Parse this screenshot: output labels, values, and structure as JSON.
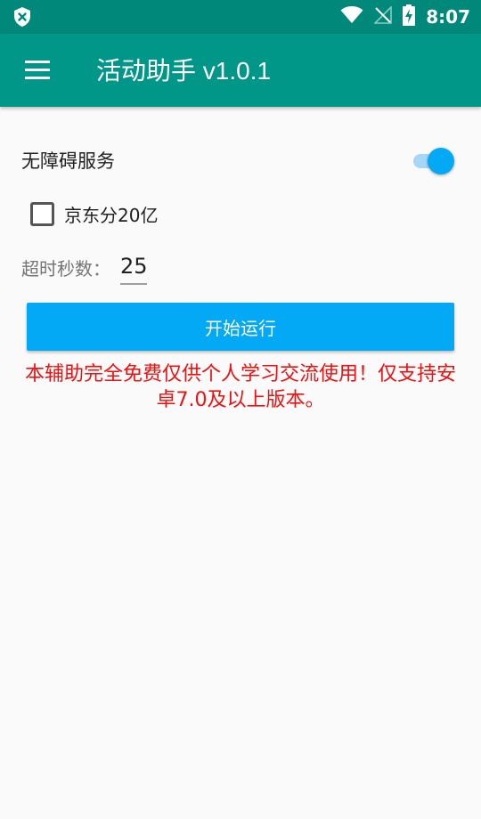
{
  "status_bar": {
    "time": "8:07",
    "icons": [
      "shield-icon",
      "wifi-icon",
      "no-signal-icon",
      "battery-charging-icon"
    ]
  },
  "app_bar": {
    "title": "活动助手 v1.0.1",
    "menu_icon": "menu-icon",
    "color": "#009688"
  },
  "accessibility": {
    "label": "无障碍服务",
    "enabled": true,
    "accent": "#03a9f4"
  },
  "option": {
    "label": "京东分20亿",
    "checked": false
  },
  "timeout": {
    "label": "超时秒数：",
    "value": "25"
  },
  "start_button": {
    "label": "开始运行",
    "color": "#03a9f4"
  },
  "notice": {
    "text": "本辅助完全免费仅供个人学习交流使用！仅支持安卓7.0及以上版本。",
    "color": "#ef1010"
  }
}
